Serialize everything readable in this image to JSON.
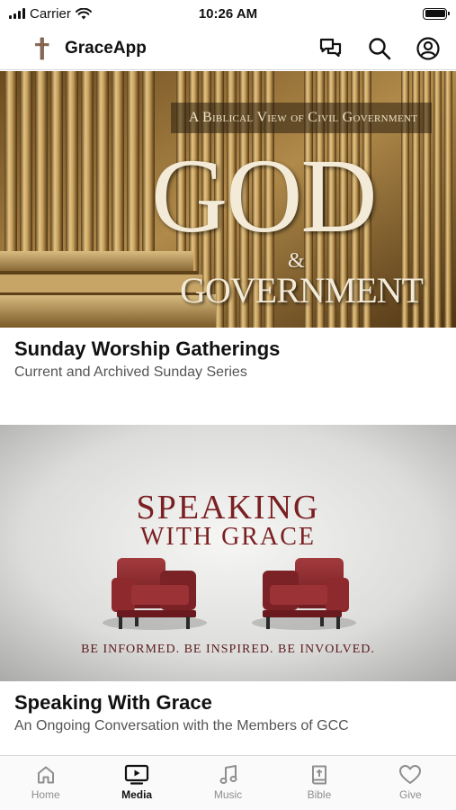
{
  "status_bar": {
    "carrier": "Carrier",
    "time": "10:26 AM"
  },
  "header": {
    "app_title": "GraceApp",
    "icons": [
      "cross-logo-icon",
      "chat-icon",
      "search-icon",
      "account-icon"
    ]
  },
  "cards": [
    {
      "image": {
        "kicker": "A Biblical View of Civil Government",
        "headline_main": "GOD",
        "headline_amp": "&",
        "headline_sub": "GOVERNMENT"
      },
      "title": "Sunday Worship Gatherings",
      "subtitle": "Current and Archived Sunday Series"
    },
    {
      "image": {
        "headline_line1": "SPEAKING",
        "headline_line2": "WITH GRACE",
        "tagline": "BE INFORMED. BE INSPIRED. BE INVOLVED."
      },
      "title": "Speaking With Grace",
      "subtitle": "An Ongoing Conversation with the Members of GCC"
    }
  ],
  "tab_bar": {
    "tabs": [
      {
        "label": "Home",
        "icon": "home-icon",
        "active": false
      },
      {
        "label": "Media",
        "icon": "tv-play-icon",
        "active": true
      },
      {
        "label": "Music",
        "icon": "music-note-icon",
        "active": false
      },
      {
        "label": "Bible",
        "icon": "bible-icon",
        "active": false
      },
      {
        "label": "Give",
        "icon": "heart-icon",
        "active": false
      }
    ]
  },
  "colors": {
    "accent_active": "#111111",
    "inactive": "#8e8e8e",
    "brand_red": "#7a1f22"
  }
}
